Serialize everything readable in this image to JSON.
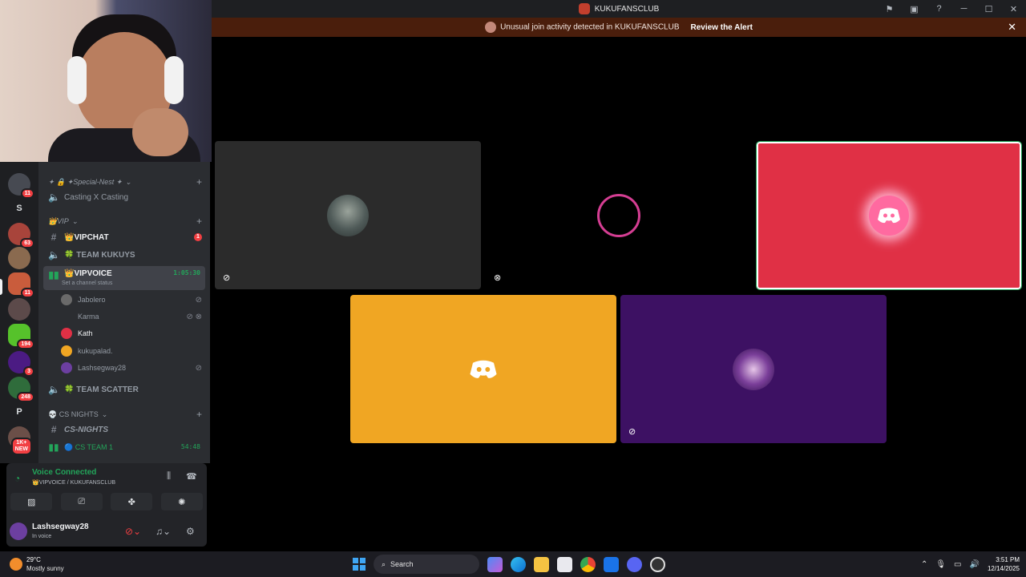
{
  "window": {
    "title": "KUKUFANSCLUB"
  },
  "alert": {
    "text": "Unusual join activity detected in KUKUFANSCLUB",
    "action": "Review the Alert"
  },
  "rail": {
    "badges": [
      "11",
      "63",
      "11",
      "194",
      "3",
      "248",
      "1K+",
      "NEW"
    ],
    "letters": [
      "S",
      "P"
    ]
  },
  "channels": {
    "categories": [
      {
        "name": "✦ 🔒 ✦Special-Nest ✦"
      },
      {
        "name": "👑VIP"
      },
      {
        "name": "💀 CS NIGHTS"
      }
    ],
    "items": [
      {
        "name": "Casting X Casting"
      },
      {
        "name": "👑VIPCHAT",
        "unread": "1"
      },
      {
        "name": "🍀 TEAM KUKUYS"
      },
      {
        "name": "👑VIPVOICE",
        "timer": "1:05:30",
        "status": "Set a channel status"
      },
      {
        "name": "🍀 TEAM SCATTER"
      },
      {
        "name": "CS-NIGHTS"
      },
      {
        "name": "🔵 CS TEAM 1",
        "timer": "54:48"
      }
    ],
    "members": [
      "Jabolero",
      "Karma",
      "Kath",
      "kukupalad.",
      "Lashsegway28"
    ]
  },
  "voice": {
    "label": "Voice Connected",
    "sub": "👑VIPVOICE / KUKUFANSCLUB"
  },
  "user": {
    "name": "Lashsegway28",
    "status": "In voice"
  },
  "taskbar": {
    "temp": "29°C",
    "condition": "Mostly sunny",
    "search": "Search",
    "time": "3:51 PM",
    "date": "12/14/2025"
  },
  "colors": {
    "tile_dark": "#2b2b2b",
    "tile_red": "#e03045",
    "tile_orange": "#f0a623",
    "tile_purple": "#3d1163",
    "accent_green": "#23a55a",
    "alert_bg": "#4a1e0c"
  }
}
